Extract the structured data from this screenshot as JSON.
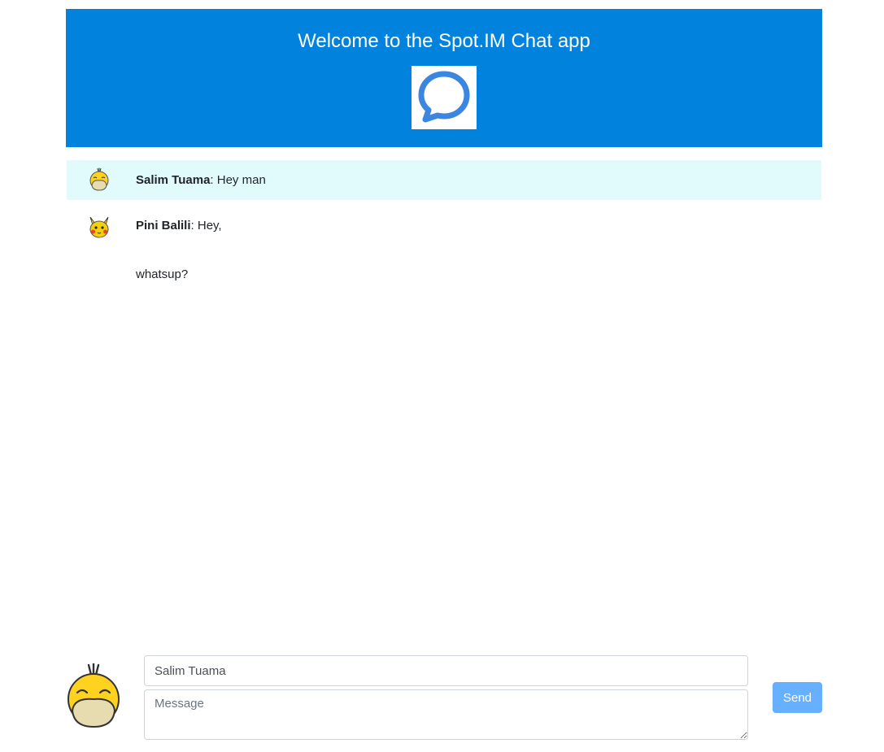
{
  "header": {
    "title": "Welcome to the Spot.IM Chat app",
    "logo_icon": "chat-bubble-icon"
  },
  "messages": [
    {
      "author": "Salim Tuama",
      "separator": ":",
      "text": " Hey man",
      "avatar_icon": "psyduck-avatar-icon",
      "highlighted": true
    },
    {
      "author": "Pini Balili",
      "separator": ":",
      "text": " Hey,",
      "text_line2": "whatsup?",
      "avatar_icon": "pikachu-avatar-icon",
      "highlighted": false
    }
  ],
  "composer": {
    "avatar_icon": "psyduck-avatar-icon",
    "name_value": "Salim Tuama",
    "message_placeholder": "Message",
    "send_label": "Send"
  },
  "colors": {
    "header_bg": "#0082dd",
    "highlight_row": "#e1fbfd",
    "send_button": "#66b0ff"
  }
}
